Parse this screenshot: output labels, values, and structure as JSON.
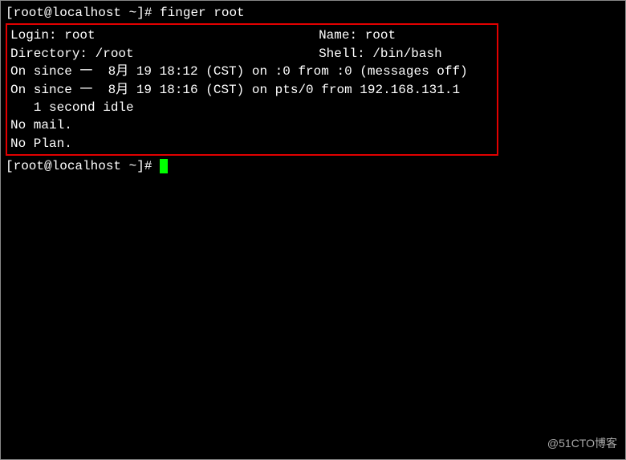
{
  "prompt1": "[root@localhost ~]# ",
  "command": "finger root",
  "output": {
    "login_label": "Login: ",
    "login_value": "root",
    "name_label": "Name: ",
    "name_value": "root",
    "directory_label": "Directory: ",
    "directory_value": "/root",
    "shell_label": "Shell: ",
    "shell_value": "/bin/bash",
    "session1": "On since 一  8月 19 18:12 (CST) on :0 from :0 (messages off)",
    "session2": "On since 一  8月 19 18:16 (CST) on pts/0 from 192.168.131.1",
    "idle": "   1 second idle",
    "nomail": "No mail.",
    "noplan": "No Plan."
  },
  "prompt2": "[root@localhost ~]# ",
  "watermark": "@51CTO博客"
}
